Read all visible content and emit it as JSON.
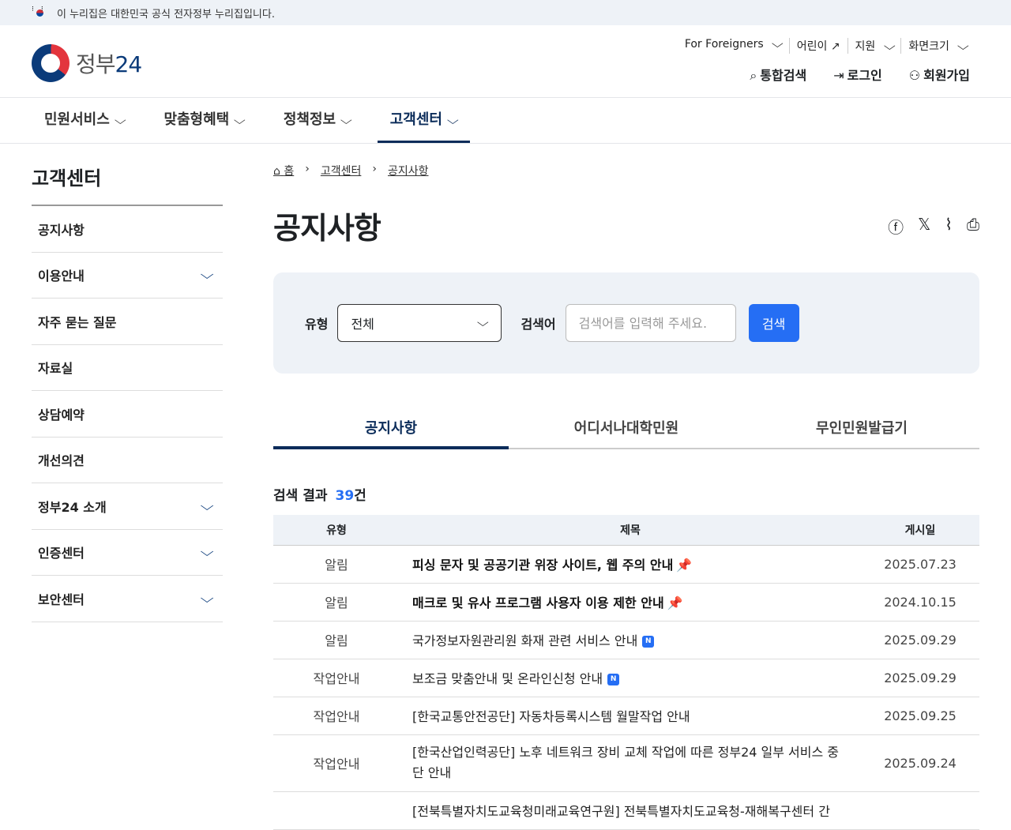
{
  "banner": {
    "text": "이 누리집은 대한민국 공식 전자정부 누리집입니다."
  },
  "logo": {
    "text_a": "정부",
    "text_b": "24"
  },
  "util": [
    "For Foreigners",
    "어린이",
    "지원",
    "화면크기"
  ],
  "actions": {
    "search": "통합검색",
    "login": "로그인",
    "signup": "회원가입"
  },
  "nav": [
    "민원서비스",
    "맞춤형혜택",
    "정책정보",
    "고객센터"
  ],
  "sidebar": {
    "title": "고객센터",
    "items": [
      {
        "label": "공지사항"
      },
      {
        "label": "이용안내"
      },
      {
        "label": "자주 묻는 질문"
      },
      {
        "label": "자료실"
      },
      {
        "label": "상담예약"
      },
      {
        "label": "개선의견"
      },
      {
        "label": "정부24 소개"
      },
      {
        "label": "인증센터"
      },
      {
        "label": "보안센터"
      }
    ]
  },
  "breadcrumb": {
    "home": "홈",
    "c1": "고객센터",
    "c2": "공지사항"
  },
  "page": {
    "title": "공지사항"
  },
  "search": {
    "type_label": "유형",
    "type_value": "전체",
    "keyword_label": "검색어",
    "placeholder": "검색어를 입력해 주세요.",
    "button": "검색"
  },
  "tabs": [
    "공지사항",
    "어디서나대학민원",
    "무인민원발급기"
  ],
  "results": {
    "label": "검색 결과",
    "count": "39",
    "unit": "건"
  },
  "table": {
    "headers": [
      "유형",
      "제목",
      "게시일"
    ],
    "rows": [
      {
        "type": "알림",
        "title": "피싱 문자 및 공공기관 위장 사이트, 웹 주의 안내",
        "date": "2025.07.23"
      },
      {
        "type": "알림",
        "title": "매크로 및 유사 프로그램 사용자 이용 제한 안내",
        "date": "2024.10.15"
      },
      {
        "type": "알림",
        "title": "국가정보자원관리원 화재 관련 서비스 안내",
        "date": "2025.09.29",
        "badge": "N"
      },
      {
        "type": "작업안내",
        "title": "보조금 맞춤안내 및 온라인신청 안내",
        "date": "2025.09.29",
        "badge": "N"
      },
      {
        "type": "작업안내",
        "title": "[한국교통안전공단] 자동차등록시스템 월말작업 안내",
        "date": "2025.09.25"
      },
      {
        "type": "작업안내",
        "title": "[한국산업인력공단] 노후 네트워크 장비 교체 작업에 따른 정부24 일부 서비스 중단 안내",
        "date": "2025.09.24"
      },
      {
        "type": "",
        "title": "[전북특별자치도교육청미래교육연구원] 전북특별자치도교육청-재해복구센터 간",
        "date": ""
      }
    ]
  }
}
